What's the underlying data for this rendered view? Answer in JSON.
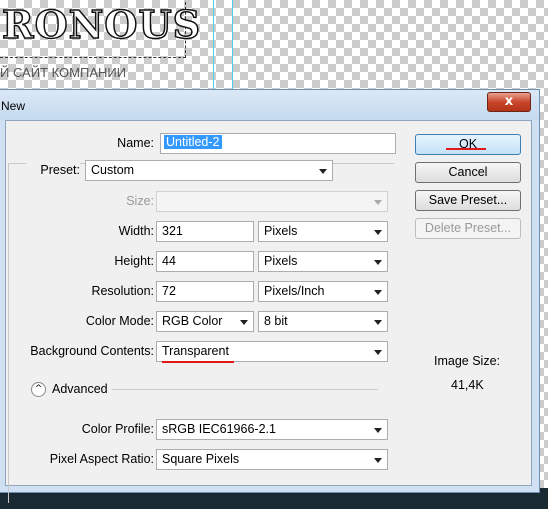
{
  "background": {
    "logo_text": "RONOUS",
    "slogan": "Й САЙТ КОМПАНИИ"
  },
  "dialog": {
    "title": "New",
    "close_glyph": "x",
    "name_label": "Name:",
    "name_value": "Untitled-2",
    "preset_label": "Preset:",
    "preset_value": "Custom",
    "size_label": "Size:",
    "size_value": "",
    "width_label": "Width:",
    "width_value": "321",
    "width_unit": "Pixels",
    "height_label": "Height:",
    "height_value": "44",
    "height_unit": "Pixels",
    "resolution_label": "Resolution:",
    "resolution_value": "72",
    "resolution_unit": "Pixels/Inch",
    "color_mode_label": "Color Mode:",
    "color_mode_value": "RGB Color",
    "bit_depth_value": "8 bit",
    "bg_contents_label": "Background Contents:",
    "bg_contents_value": "Transparent",
    "advanced_label": "Advanced",
    "advanced_toggle_glyph": "^",
    "color_profile_label": "Color Profile:",
    "color_profile_value": "sRGB IEC61966-2.1",
    "pixel_aspect_label": "Pixel Aspect Ratio:",
    "pixel_aspect_value": "Square Pixels",
    "buttons": {
      "ok": "OK",
      "cancel": "Cancel",
      "save_preset": "Save Preset...",
      "delete_preset": "Delete Preset..."
    },
    "image_size_label": "Image Size:",
    "image_size_value": "41,4K"
  },
  "colors": {
    "annotation_red": "#e01818",
    "selection_blue": "#3399ff"
  }
}
